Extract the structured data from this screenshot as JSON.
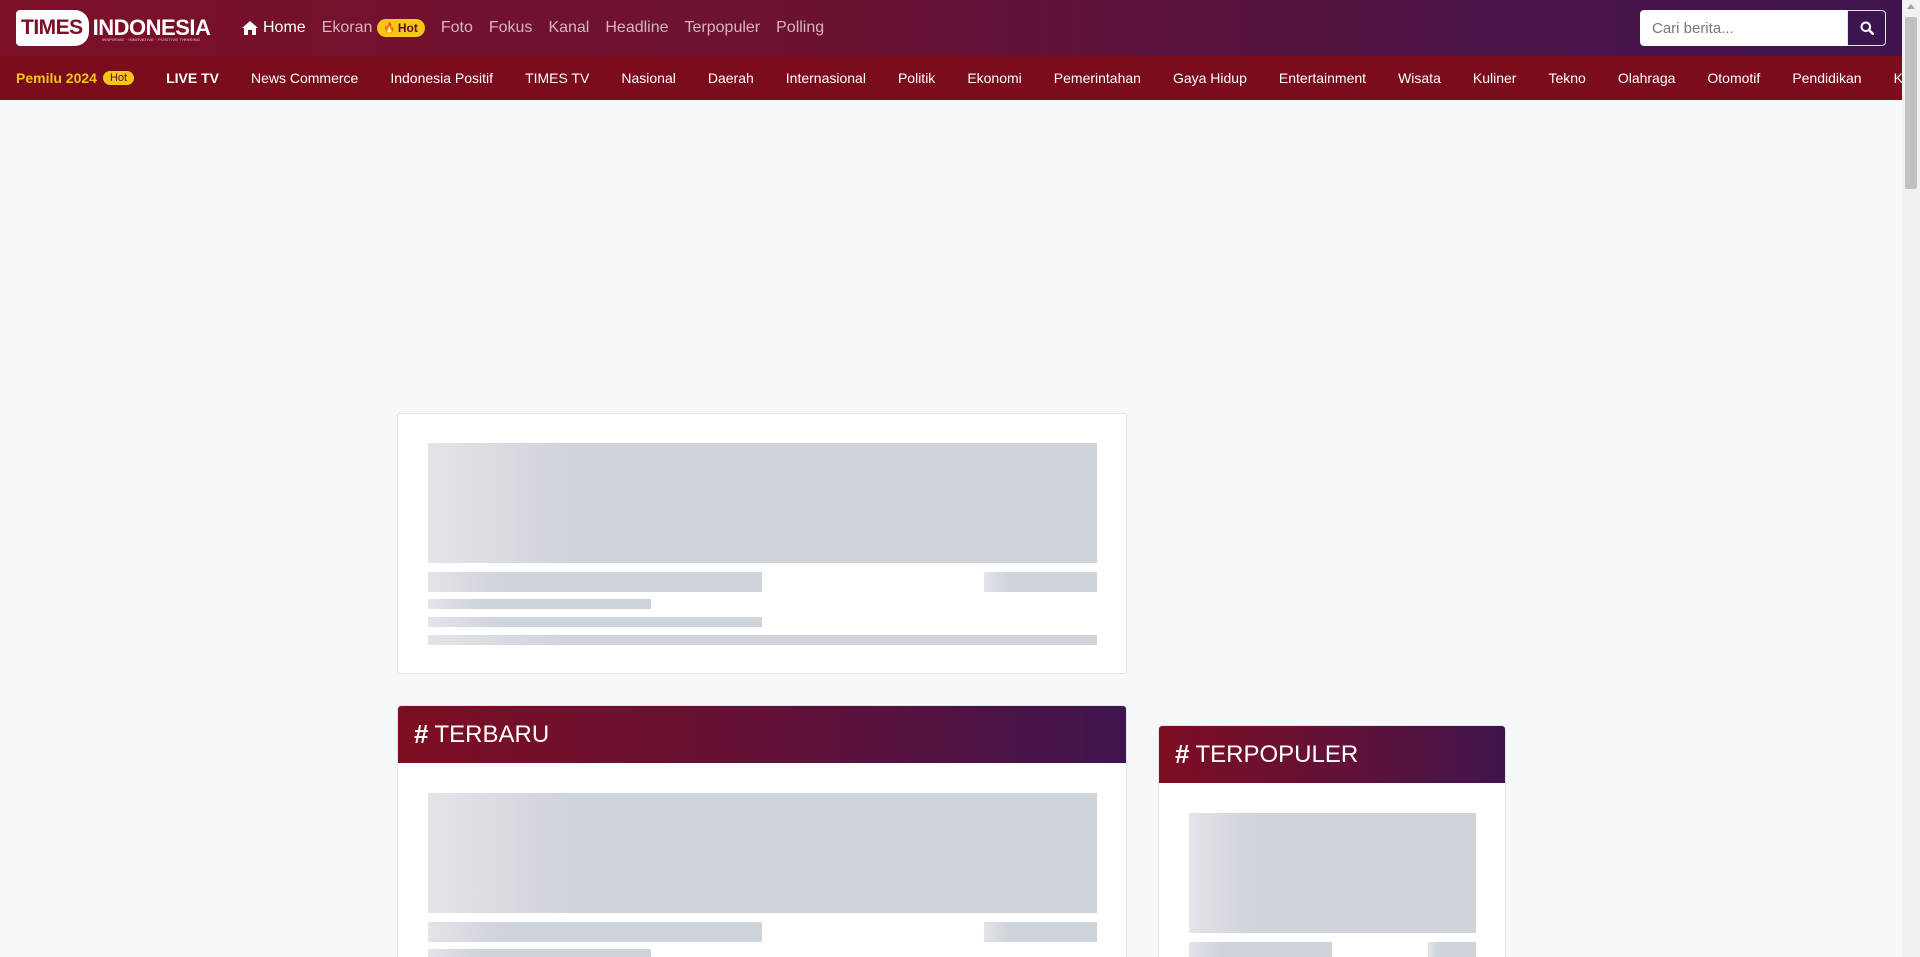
{
  "logo": {
    "word1": "TIMES",
    "word2": "INDONESIA",
    "tagline": "INSPIRING · INNOVATIVE · POSITIVE THINKING"
  },
  "main_nav": {
    "items": [
      {
        "label": "Home",
        "active": true,
        "icon": "home-icon"
      },
      {
        "label": "Ekoran",
        "badge": "Hot",
        "badge_icon": "fire-icon"
      },
      {
        "label": "Foto"
      },
      {
        "label": "Fokus"
      },
      {
        "label": "Kanal"
      },
      {
        "label": "Headline"
      },
      {
        "label": "Terpopuler"
      },
      {
        "label": "Polling"
      }
    ]
  },
  "search": {
    "placeholder": "Cari berita...",
    "button_icon": "search-icon"
  },
  "sub_nav": {
    "feature": {
      "label": "Pemilu 2024",
      "badge": "Hot"
    },
    "items": [
      "LIVE TV",
      "News Commerce",
      "Indonesia Positif",
      "TIMES TV",
      "Nasional",
      "Daerah",
      "Internasional",
      "Politik",
      "Ekonomi",
      "Pemerintahan",
      "Gaya Hidup",
      "Entertainment",
      "Wisata",
      "Kuliner",
      "Tekno",
      "Olahraga",
      "Otomotif",
      "Pendidikan",
      "Kesehatan"
    ]
  },
  "sections": {
    "latest": {
      "title": "TERBARU"
    },
    "popular": {
      "title": "TERPOPULER"
    }
  },
  "colors": {
    "brand": "#7b1026",
    "brand_dark": "#3f144d",
    "subnav": "#7b0c1c",
    "hot": "#f5c518",
    "skeleton": "#cfd3da"
  }
}
